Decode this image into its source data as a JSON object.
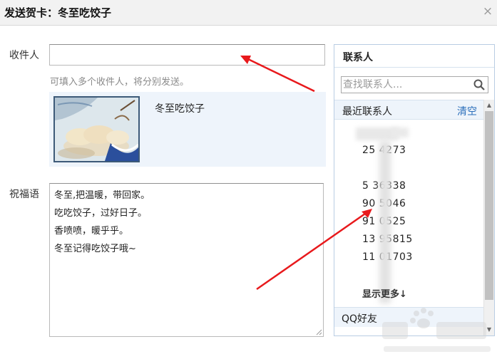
{
  "window": {
    "title": "发送贺卡：冬至吃饺子",
    "close_glyph": "×"
  },
  "form": {
    "recipient_label": "收件人",
    "recipient_value": "",
    "recipient_hint": "可填入多个收件人，将分别发送。",
    "card_name": "冬至吃饺子",
    "greeting_label": "祝福语",
    "greeting_lines": [
      "冬至,把温暖，带回家。",
      "吃吃饺子，过好日子。",
      "香喷喷，暖乎乎。",
      "冬至记得吃饺子哦~"
    ]
  },
  "contacts": {
    "title": "联系人",
    "search_placeholder": "查找联系人...",
    "recent_label": "最近联系人",
    "clear_label": "清空",
    "items": [
      "25    4273",
      "5    36338",
      "90    5046",
      "91    0525",
      "13    95815",
      "11    01703"
    ],
    "show_more_label": "显示更多↓",
    "qq_friends_label": "QQ好友"
  },
  "icons": {
    "close": "close-icon",
    "search": "search-icon",
    "scroll_up": "scroll-up-icon",
    "scroll_down": "scroll-down-icon"
  },
  "colors": {
    "link": "#2a6ebb",
    "panel_bg": "#eef4fb",
    "annotation_arrow": "#e8191c"
  }
}
